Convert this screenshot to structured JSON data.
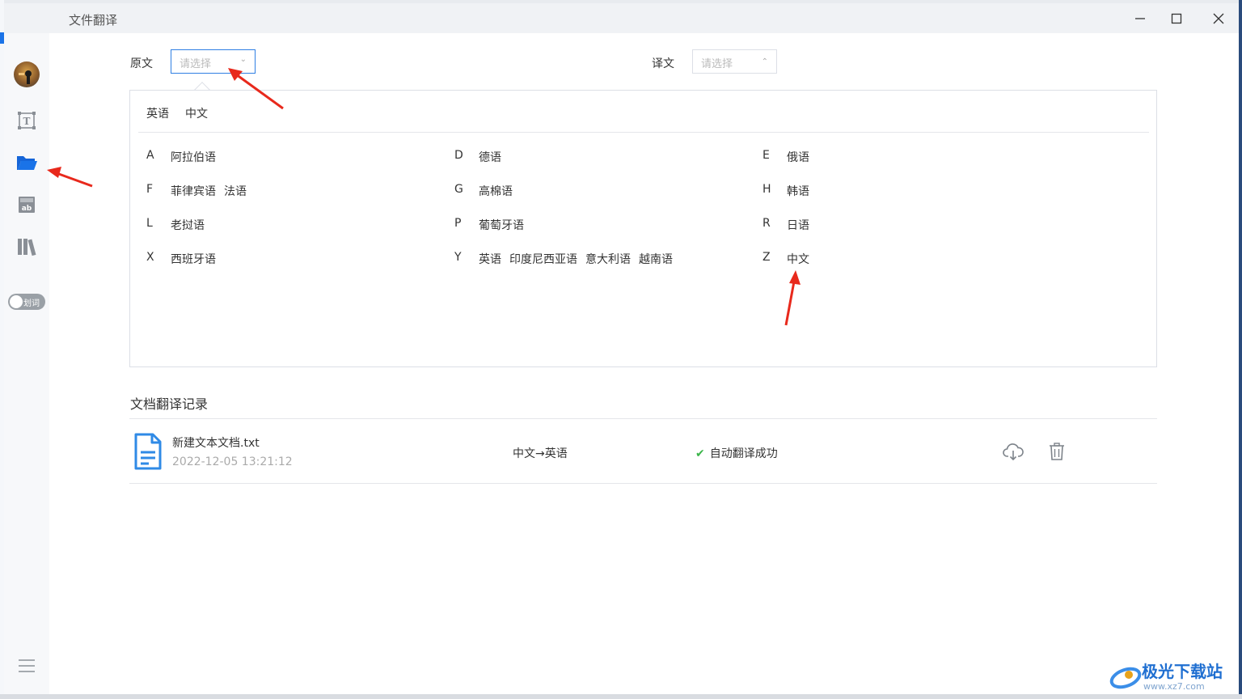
{
  "window": {
    "title": "文件翻译",
    "controls": {
      "minimize": "minimize-icon",
      "maximize": "maximize-icon",
      "close": "close-icon"
    }
  },
  "sidebar": {
    "items": [
      {
        "name": "avatar"
      },
      {
        "icon": "text-recognition-icon"
      },
      {
        "icon": "folder-icon",
        "active": true
      },
      {
        "icon": "ab-image-icon"
      },
      {
        "icon": "library-icon"
      }
    ],
    "toggle_label": "划词",
    "menu_icon": "hamburger-menu-icon"
  },
  "source": {
    "label": "原文",
    "placeholder": "请选择"
  },
  "target": {
    "label": "译文",
    "placeholder": "请选择"
  },
  "dropdown": {
    "quick": [
      "英语",
      "中文"
    ],
    "groups": [
      {
        "letter": "A",
        "langs": [
          "阿拉伯语"
        ]
      },
      {
        "letter": "D",
        "langs": [
          "德语"
        ]
      },
      {
        "letter": "E",
        "langs": [
          "俄语"
        ]
      },
      {
        "letter": "F",
        "langs": [
          "菲律宾语",
          "法语"
        ]
      },
      {
        "letter": "G",
        "langs": [
          "高棉语"
        ]
      },
      {
        "letter": "H",
        "langs": [
          "韩语"
        ]
      },
      {
        "letter": "L",
        "langs": [
          "老挝语"
        ]
      },
      {
        "letter": "P",
        "langs": [
          "葡萄牙语"
        ]
      },
      {
        "letter": "R",
        "langs": [
          "日语"
        ]
      },
      {
        "letter": "X",
        "langs": [
          "西班牙语"
        ]
      },
      {
        "letter": "Y",
        "langs": [
          "英语",
          "印度尼西亚语",
          "意大利语",
          "越南语"
        ]
      },
      {
        "letter": "Z",
        "langs": [
          "中文"
        ]
      }
    ]
  },
  "history": {
    "title": "文档翻译记录",
    "records": [
      {
        "file_name": "新建文本文档.txt",
        "time": "2022-12-05 13:21:12",
        "direction": "中文→英语",
        "status": "自动翻译成功"
      }
    ]
  },
  "watermark": {
    "text": "极光下载站",
    "sub": "www.xz7.com"
  },
  "colors": {
    "accent": "#2f7fe3",
    "success": "#3bb54a",
    "annotation": "#e8291c"
  }
}
